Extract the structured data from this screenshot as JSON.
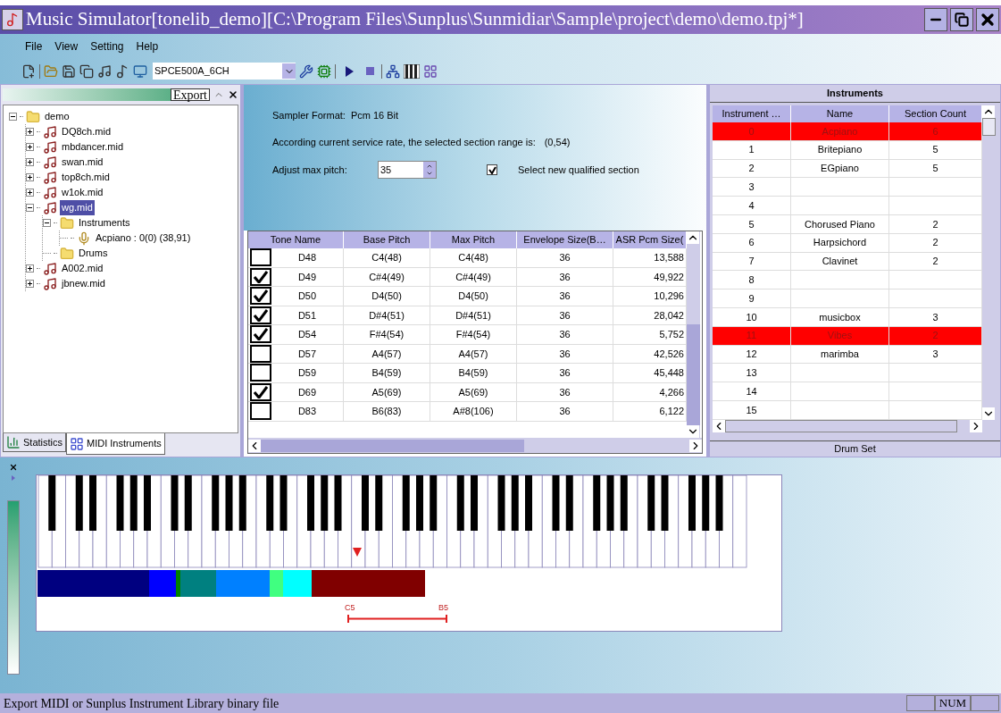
{
  "window": {
    "title": "Music Simulator[tonelib_demo][C:\\Program Files\\Sunplus\\Sunmidiar\\Sample\\project\\demo\\demo.tpj*]"
  },
  "menu": [
    "File",
    "View",
    "Setting",
    "Help"
  ],
  "toolbar": {
    "device": "SPCE500A_6CH"
  },
  "left_panel": {
    "export_button": "Export",
    "tree": [
      {
        "label": "demo",
        "kind": "folder",
        "expanded": true,
        "selected": false,
        "children": [
          {
            "label": "DQ8ch.mid",
            "kind": "midi",
            "expanded": false,
            "selected": false
          },
          {
            "label": "mbdancer.mid",
            "kind": "midi",
            "expanded": false,
            "selected": false
          },
          {
            "label": "swan.mid",
            "kind": "midi",
            "expanded": false,
            "selected": false
          },
          {
            "label": "top8ch.mid",
            "kind": "midi",
            "expanded": false,
            "selected": false
          },
          {
            "label": "w1ok.mid",
            "kind": "midi",
            "expanded": false,
            "selected": false
          },
          {
            "label": "wg.mid",
            "kind": "midi",
            "expanded": true,
            "selected": true,
            "children": [
              {
                "label": "Instruments",
                "kind": "folder",
                "expanded": true,
                "selected": false,
                "children": [
                  {
                    "label": "Acpiano : 0(0) (38,91)",
                    "kind": "instrument",
                    "selected": false
                  }
                ]
              },
              {
                "label": "Drums",
                "kind": "folder",
                "selected": false
              }
            ]
          },
          {
            "label": "A002.mid",
            "kind": "midi",
            "expanded": false,
            "selected": false
          },
          {
            "label": "jbnew.mid",
            "kind": "midi",
            "expanded": false,
            "selected": false
          }
        ]
      }
    ],
    "tabs": [
      {
        "label": "Statistics",
        "selected": false
      },
      {
        "label": "MIDI Instruments",
        "selected": true
      }
    ]
  },
  "sampler": {
    "format_label": "Sampler Format:",
    "format_value": "Pcm 16 Bit",
    "range_text": "According current service rate, the selected section range is:",
    "range_value": "(0,54)",
    "pitch_label": "Adjust max pitch:",
    "pitch_value": "35",
    "qualified": {
      "label": "Select new qualified section",
      "checked": true
    }
  },
  "tones": {
    "columns": [
      "Tone Name",
      "Base Pitch",
      "Max Pitch",
      "Envelope Size(B…",
      "ASR Pcm Size("
    ],
    "rows": [
      {
        "checked": false,
        "cells": [
          "D48",
          "C4(48)",
          "C4(48)",
          "36",
          "13,588"
        ]
      },
      {
        "checked": true,
        "cells": [
          "D49",
          "C#4(49)",
          "C#4(49)",
          "36",
          "49,922"
        ]
      },
      {
        "checked": true,
        "cells": [
          "D50",
          "D4(50)",
          "D4(50)",
          "36",
          "10,296"
        ]
      },
      {
        "checked": true,
        "cells": [
          "D51",
          "D#4(51)",
          "D#4(51)",
          "36",
          "28,042"
        ]
      },
      {
        "checked": true,
        "cells": [
          "D54",
          "F#4(54)",
          "F#4(54)",
          "36",
          "5,752"
        ]
      },
      {
        "checked": false,
        "cells": [
          "D57",
          "A4(57)",
          "A4(57)",
          "36",
          "42,526"
        ]
      },
      {
        "checked": false,
        "cells": [
          "D59",
          "B4(59)",
          "B4(59)",
          "36",
          "45,448"
        ]
      },
      {
        "checked": true,
        "cells": [
          "D69",
          "A5(69)",
          "A5(69)",
          "36",
          "4,266"
        ]
      },
      {
        "checked": false,
        "cells": [
          "D83",
          "B6(83)",
          "A#8(106)",
          "36",
          "6,122"
        ]
      }
    ]
  },
  "instruments": {
    "title": "Instruments",
    "columns": [
      "Instrument …",
      "Name",
      "Section Count"
    ],
    "rows": [
      {
        "highlighted": true,
        "cells": [
          "0",
          "Acpiano",
          "6"
        ]
      },
      {
        "highlighted": false,
        "cells": [
          "1",
          "Britepiano",
          "5"
        ]
      },
      {
        "highlighted": false,
        "cells": [
          "2",
          "EGpiano",
          "5"
        ]
      },
      {
        "highlighted": false,
        "cells": [
          "3"
        ]
      },
      {
        "highlighted": false,
        "cells": [
          "4"
        ]
      },
      {
        "highlighted": false,
        "cells": [
          "5",
          "Chorused Piano",
          "2"
        ]
      },
      {
        "highlighted": false,
        "cells": [
          "6",
          "Harpsichord",
          "2"
        ]
      },
      {
        "highlighted": false,
        "cells": [
          "7",
          "Clavinet",
          "2"
        ]
      },
      {
        "highlighted": false,
        "cells": [
          "8"
        ]
      },
      {
        "highlighted": false,
        "cells": [
          "9"
        ]
      },
      {
        "highlighted": false,
        "cells": [
          "10",
          "musicbox",
          "3"
        ]
      },
      {
        "highlighted": true,
        "cells": [
          "11",
          "Vibes",
          "2"
        ]
      },
      {
        "highlighted": false,
        "cells": [
          "12",
          "marimba",
          "3"
        ]
      },
      {
        "highlighted": false,
        "cells": [
          "13"
        ]
      },
      {
        "highlighted": false,
        "cells": [
          "14"
        ]
      },
      {
        "highlighted": false,
        "cells": [
          "15"
        ]
      }
    ],
    "footer": "Drum Set"
  },
  "keyboard": {
    "range_start": "C5",
    "range_end": "B5"
  },
  "status_bar": {
    "text": "Export MIDI or Sunplus Instrument Library binary file",
    "indicator": "NUM"
  }
}
